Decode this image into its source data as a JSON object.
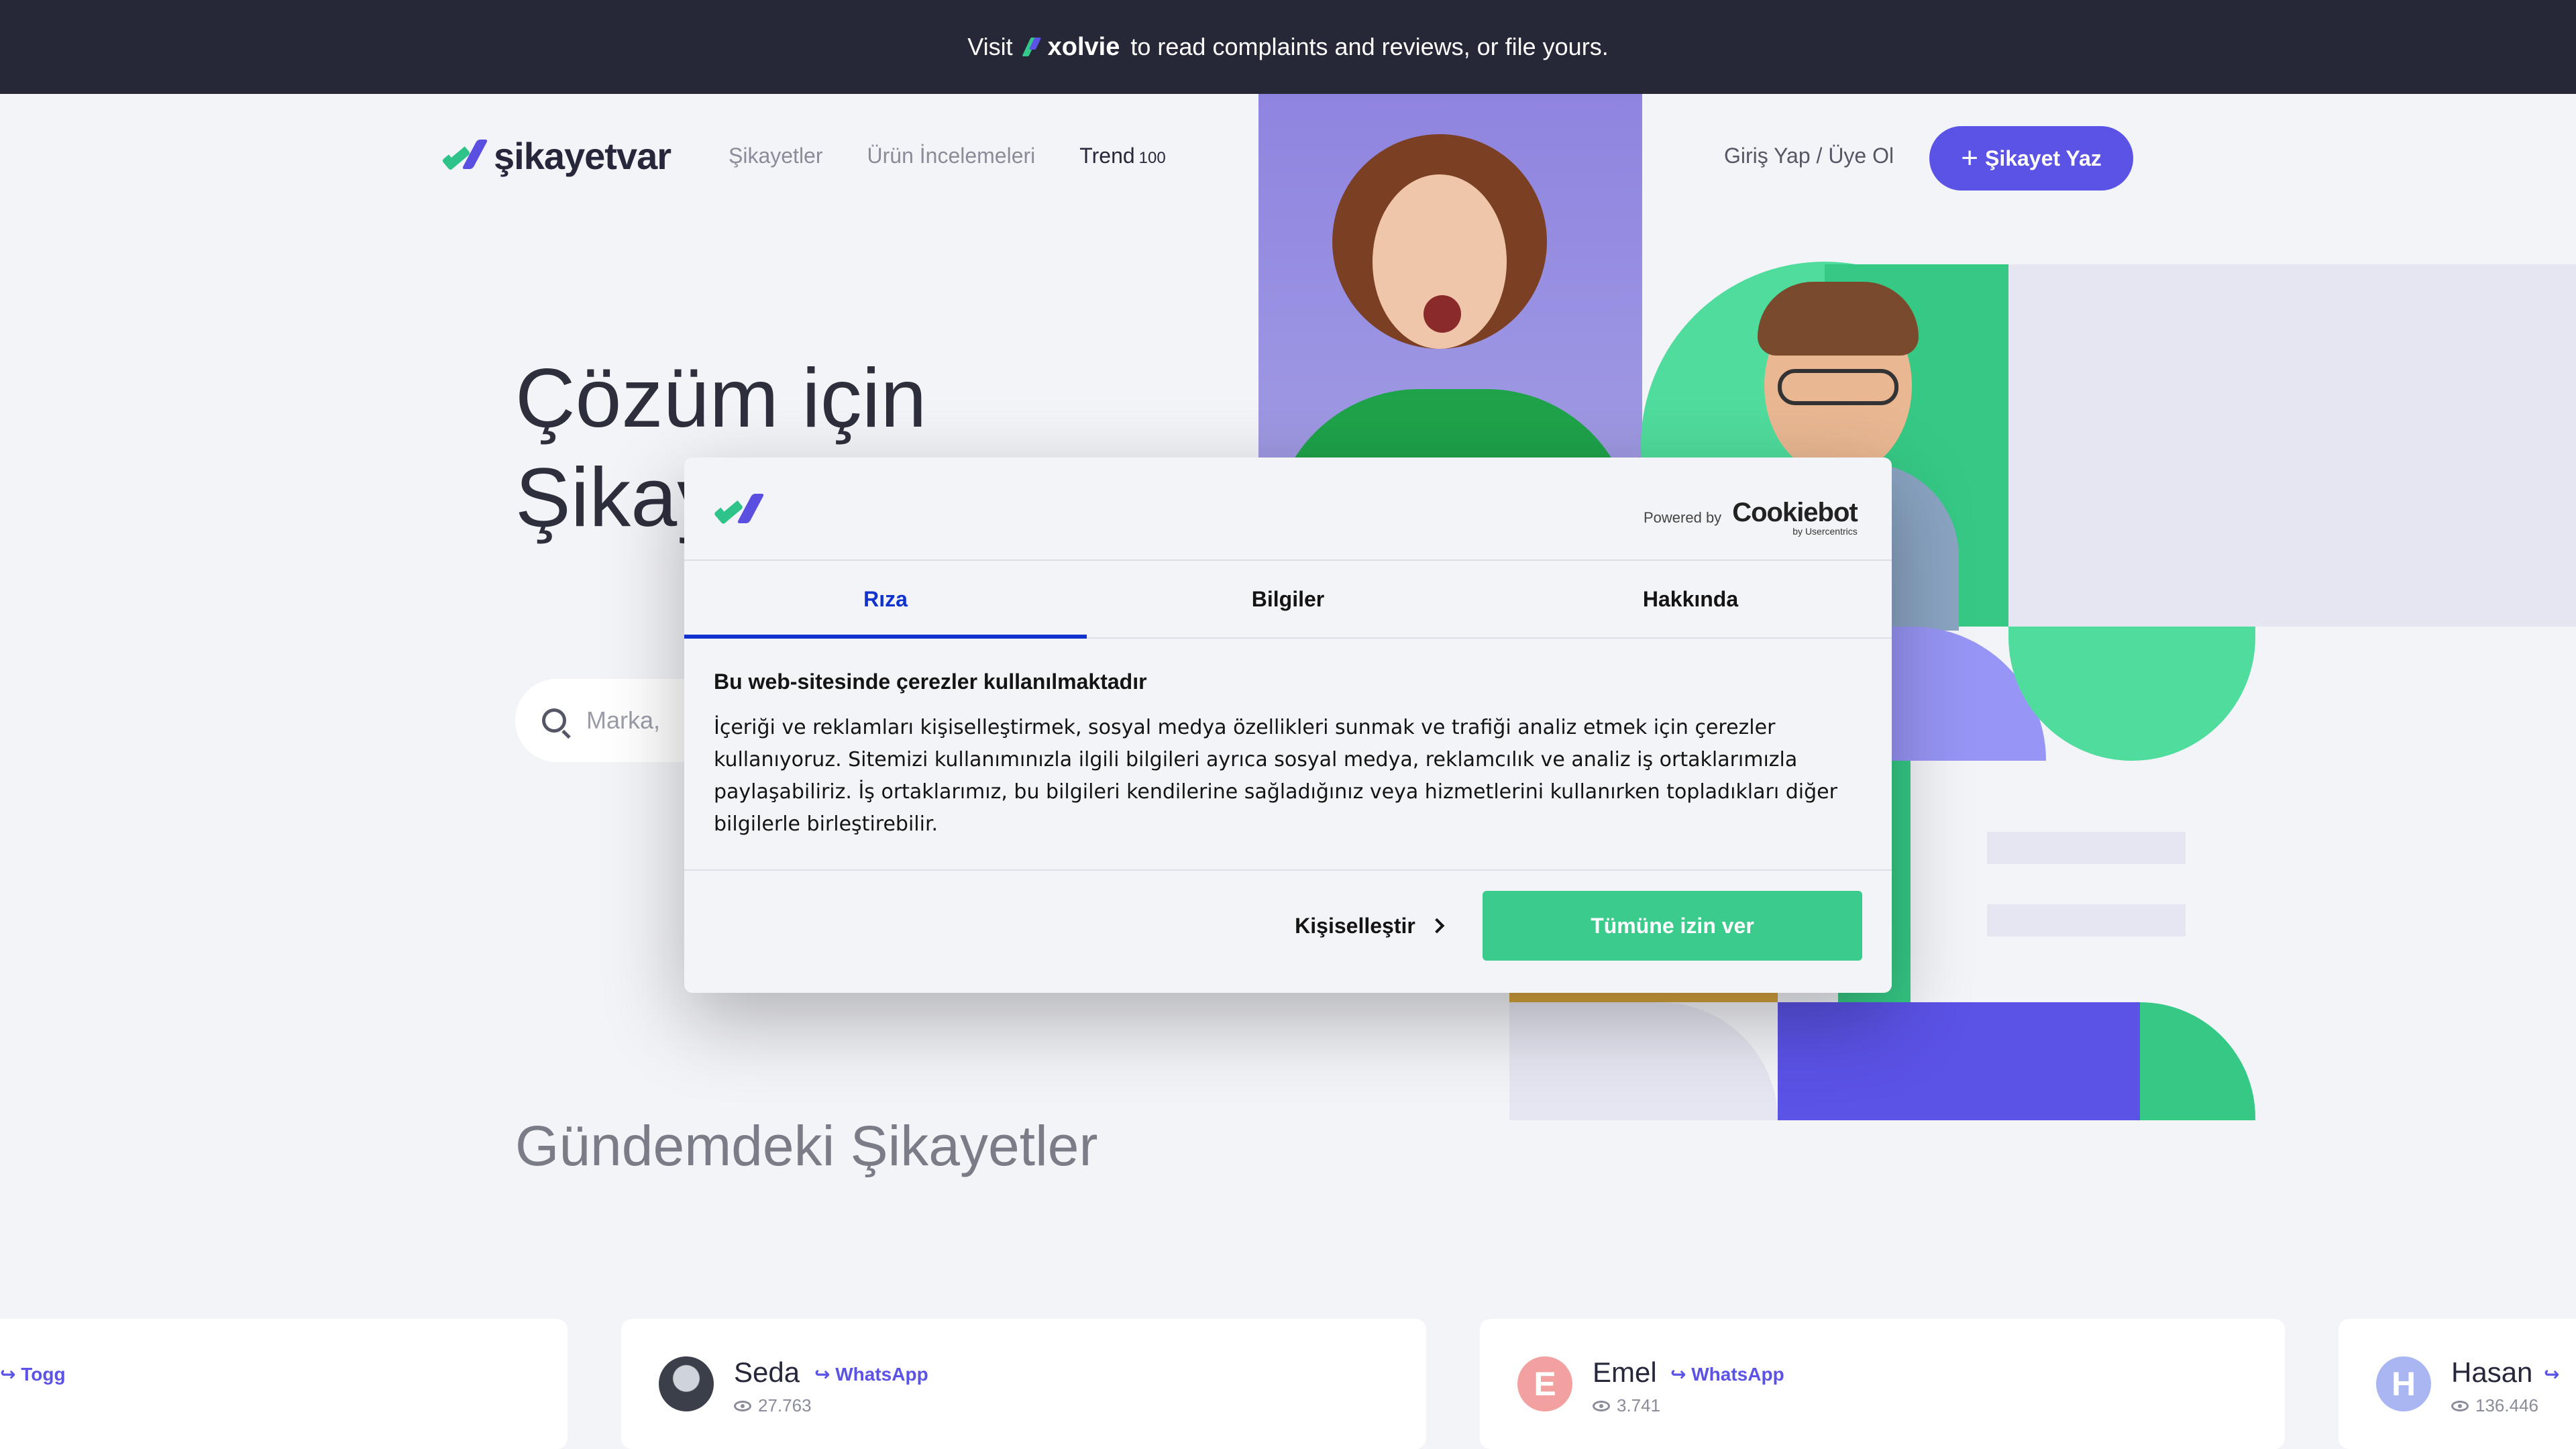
{
  "banner": {
    "prefix": "Visit",
    "brand": "xolvie",
    "suffix": "to read complaints and reviews, or file yours."
  },
  "header": {
    "logo_text": "şikayetvar",
    "nav": [
      "Şikayetler",
      "Ürün İncelemeleri",
      "Trend"
    ],
    "trend_count": "100",
    "login": "Giriş Yap / Üye Ol",
    "cta": "Şikayet Yaz"
  },
  "hero": {
    "title_line1": "Çözüm için",
    "title_line2": "Şikay",
    "search_placeholder": "Marka,"
  },
  "section": {
    "title": "Gündemdeki Şikayetler"
  },
  "cards": [
    {
      "name": "",
      "brand": "Togg",
      "views": ""
    },
    {
      "name": "Seda",
      "brand": "WhatsApp",
      "views": "27.763",
      "avatar": ""
    },
    {
      "name": "Emel",
      "brand": "WhatsApp",
      "views": "3.741",
      "avatar": "E",
      "avatar_color": "#f2a0a0"
    },
    {
      "name": "Hasan",
      "brand": "",
      "views": "136.446",
      "avatar": "H",
      "avatar_color": "#a9b6f2"
    }
  ],
  "cookie": {
    "powered_by": "Powered by",
    "provider": "Cookiebot",
    "provider_sub": "by Usercentrics",
    "tabs": [
      "Rıza",
      "Bilgiler",
      "Hakkında"
    ],
    "heading": "Bu web-sitesinde çerezler kullanılmaktadır",
    "body": "İçeriği ve reklamları kişiselleştirmek, sosyal medya özellikleri sunmak ve trafiği analiz etmek için çerezler kullanıyoruz. Sitemizi kullanımınızla ilgili bilgileri ayrıca sosyal medya, reklamcılık ve analiz iş ortaklarımızla paylaşabiliriz. İş ortaklarımız, bu bilgileri kendilerine sağladığınız veya hizmetlerini kullanırken topladıkları diğer bilgilerle birleştirebilir.",
    "customize": "Kişiselleştir",
    "allow_all": "Tümüne izin ver"
  },
  "colors": {
    "accent": "#5b52e6",
    "green": "#3bcb8c",
    "banner": "#262838",
    "active_tab": "#1032cf"
  }
}
